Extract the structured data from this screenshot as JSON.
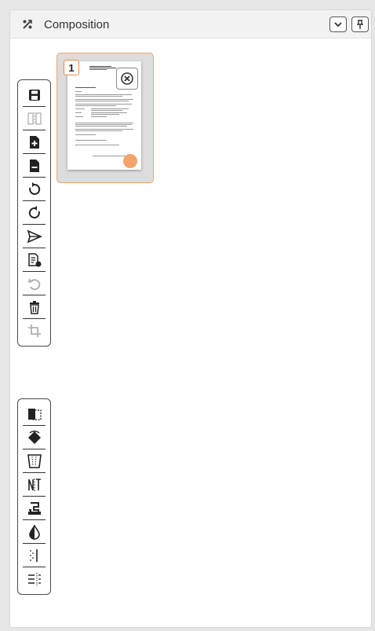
{
  "panel": {
    "title": "Composition",
    "header_icon": "composition-icon",
    "buttons": [
      "collapse-chevron-icon",
      "pin-icon"
    ]
  },
  "toolbar_top": [
    {
      "name": "save-icon",
      "disabled": false
    },
    {
      "name": "split-pages-icon",
      "disabled": true
    },
    {
      "name": "add-page-icon",
      "disabled": false
    },
    {
      "name": "remove-page-icon",
      "disabled": false
    },
    {
      "name": "rotate-right-icon",
      "disabled": false
    },
    {
      "name": "rotate-left-icon",
      "disabled": false
    },
    {
      "name": "send-icon",
      "disabled": false
    },
    {
      "name": "document-settings-icon",
      "disabled": false
    },
    {
      "name": "undo-icon",
      "disabled": true
    },
    {
      "name": "delete-icon",
      "disabled": false
    },
    {
      "name": "crop-icon",
      "disabled": true
    }
  ],
  "toolbar_bottom": [
    {
      "name": "auto-crop-icon",
      "disabled": false
    },
    {
      "name": "deskew-icon",
      "disabled": false
    },
    {
      "name": "perspective-icon",
      "disabled": false
    },
    {
      "name": "mirror-icon",
      "disabled": false
    },
    {
      "name": "stamp-icon",
      "disabled": false
    },
    {
      "name": "contrast-icon",
      "disabled": false
    },
    {
      "name": "despeckle-icon",
      "disabled": false
    },
    {
      "name": "align-lines-icon",
      "disabled": false
    }
  ],
  "thumbnail": {
    "page_number": "1",
    "close_icon": "close-circle-icon",
    "accent_color": "#f4a46a"
  }
}
